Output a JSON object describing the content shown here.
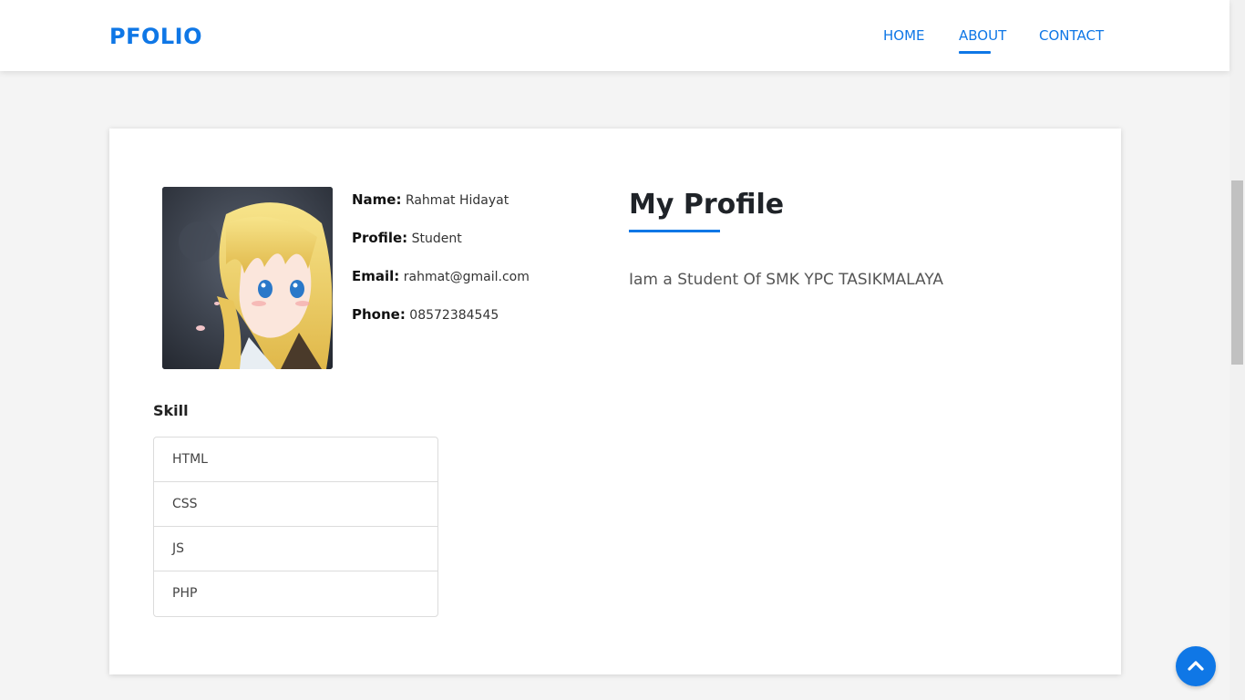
{
  "nav": {
    "brand": "PFOLIO",
    "links": [
      {
        "label": "HOME"
      },
      {
        "label": "ABOUT"
      },
      {
        "label": "CONTACT"
      }
    ],
    "active": "ABOUT",
    "accent_color": "#0f77e6"
  },
  "profile": {
    "avatar_icon": "anime-girl-avatar",
    "fields": [
      {
        "label": "Name:",
        "value": "Rahmat Hidayat"
      },
      {
        "label": "Profile:",
        "value": "Student"
      },
      {
        "label": "Email:",
        "value": "rahmat@gmail.com"
      },
      {
        "label": "Phone:",
        "value": "08572384545"
      }
    ],
    "title": "My Profile",
    "description": "Iam a Student Of SMK YPC TASIKMALAYA"
  },
  "skills": {
    "heading": "Skill",
    "items": [
      "HTML",
      "CSS",
      "JS",
      "PHP"
    ]
  },
  "back_to_top": {
    "icon": "chevron-up-icon"
  }
}
